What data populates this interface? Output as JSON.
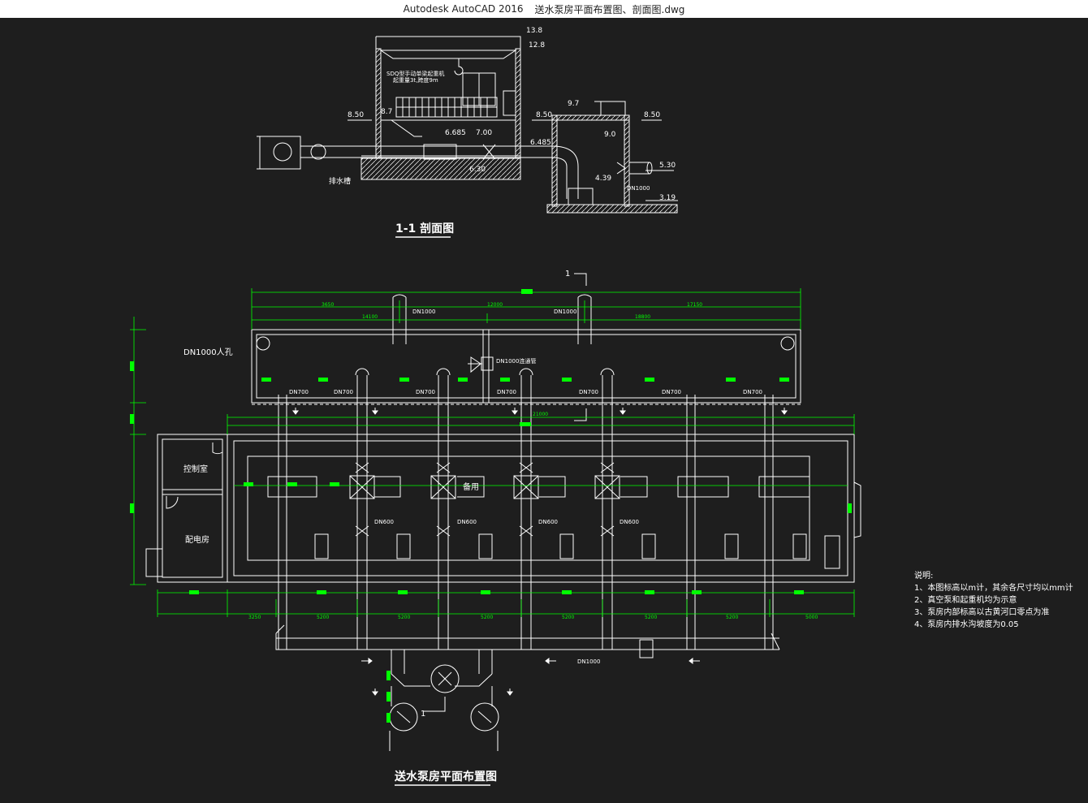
{
  "window": {
    "app": "Autodesk AutoCAD 2016",
    "file": "送水泵房平面布置图、剖面图.dwg"
  },
  "section": {
    "title": "1-1 剖面图",
    "crane_label_1": "SDQ型手动单梁起重机",
    "crane_label_2": "起重量3t,跨度9m",
    "drain_label": "排水槽",
    "pipe_label": "DN1000",
    "elevations": [
      "13.8",
      "12.8",
      "8.50",
      "8.7",
      "6.685",
      "7.00",
      "6.485",
      "6.30",
      "9.7",
      "8.50",
      "9.0",
      "8.50",
      "5.30",
      "4.39",
      "3.19"
    ]
  },
  "plan": {
    "title": "送水泵房平面布置图",
    "section_mark": "1",
    "manhole": "DN1000人孔",
    "connector": "DN1000连通管",
    "dn1000_a": "DN1000",
    "dn1000_b": "DN1000",
    "dn1000_bottom": "DN1000",
    "dn700": [
      "DN700",
      "DN700",
      "DN700",
      "DN700",
      "DN700",
      "DN700",
      "DN700"
    ],
    "dn600": [
      "DN600",
      "DN600",
      "DN600",
      "DN600"
    ],
    "control_room": "控制室",
    "power_room": "配电房",
    "spare": "备用",
    "top_dims": [
      "3650",
      "12000",
      "17150"
    ],
    "second_dims": [
      "14100",
      "18800"
    ],
    "inner_dim": "21000",
    "bottom_dims": [
      "3250",
      "5200",
      "5200",
      "5200",
      "5200",
      "5200",
      "5200",
      "5000"
    ]
  },
  "notes": {
    "heading": "说明:",
    "items": [
      "1、本图标高以m计，其余各尺寸均以mm计",
      "2、真空泵和起重机均为示意",
      "3、泵房内部标高以古黄河口零点为准",
      "4、泵房内排水沟坡度为0.05"
    ]
  },
  "colors": {
    "background": "#1e1e1e",
    "lines": "#ffffff",
    "dimensions": "#00ff00"
  }
}
